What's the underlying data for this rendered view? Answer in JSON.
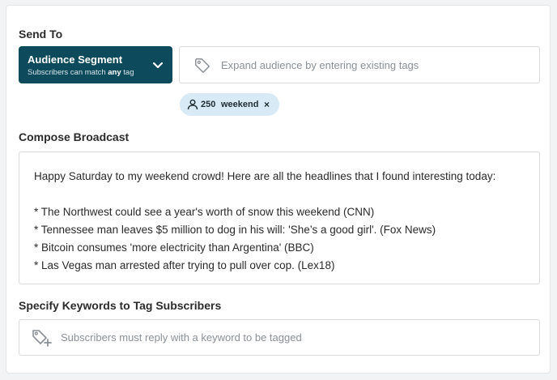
{
  "send_to": {
    "label": "Send To",
    "segment": {
      "title": "Audience Segment",
      "subtitle_prefix": "Subscribers can match ",
      "subtitle_emphasis": "any",
      "subtitle_suffix": " tag"
    },
    "tags_input": {
      "placeholder": "Expand audience by entering existing tags"
    },
    "chips": [
      {
        "count": "250",
        "name": "weekend",
        "remove": "×"
      }
    ]
  },
  "compose": {
    "label": "Compose Broadcast",
    "intro": "Happy Saturday to my weekend crowd! Here are all the  headlines that I found interesting today:",
    "lines": [
      "* The Northwest could see a year's worth of snow this weekend (CNN)",
      "* Tennessee man leaves $5 million to dog in his will: 'She’s a good girl'. (Fox News)",
      "* Bitcoin consumes 'more electricity than Argentina' (BBC)",
      "* Las Vegas man arrested after trying to pull over cop. (Lex18)"
    ]
  },
  "keywords": {
    "label": "Specify Keywords to Tag Subscribers",
    "placeholder": "Subscribers must reply with a keyword to be tagged"
  },
  "colors": {
    "segment_bg": "#0d4a5c",
    "chip_bg": "#d7eaf5",
    "border": "#d8dadc",
    "placeholder": "#8a9096"
  },
  "icons": {
    "segment_dropdown": "chevron-down-icon",
    "tags_input": "tag-icon",
    "chip_audience": "person-icon",
    "keyword_input": "tag-add-icon"
  }
}
